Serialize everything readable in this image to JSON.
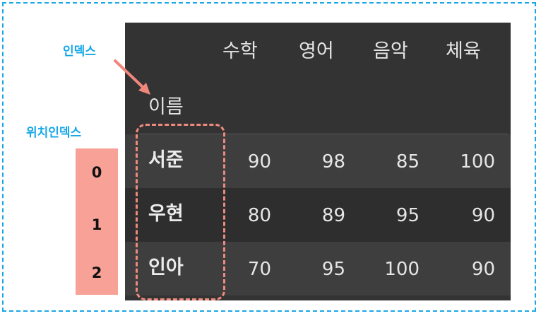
{
  "annotations": {
    "index_label": "인덱스",
    "position_index_label": "위치인덱스",
    "position_numbers": [
      "0",
      "1",
      "2"
    ]
  },
  "table": {
    "index_name": "이름",
    "columns": [
      "수학",
      "영어",
      "음악",
      "체육"
    ],
    "rows": [
      {
        "name": "서준",
        "values": [
          "90",
          "98",
          "85",
          "100"
        ]
      },
      {
        "name": "우현",
        "values": [
          "80",
          "89",
          "95",
          "90"
        ]
      },
      {
        "name": "인아",
        "values": [
          "70",
          "95",
          "100",
          "90"
        ]
      }
    ]
  },
  "colors": {
    "frame": "#1aa7e6",
    "annotation_text": "#16a7e8",
    "position_background": "#f7a197",
    "highlight": "#ef8a7f",
    "table_background": "#333333"
  }
}
